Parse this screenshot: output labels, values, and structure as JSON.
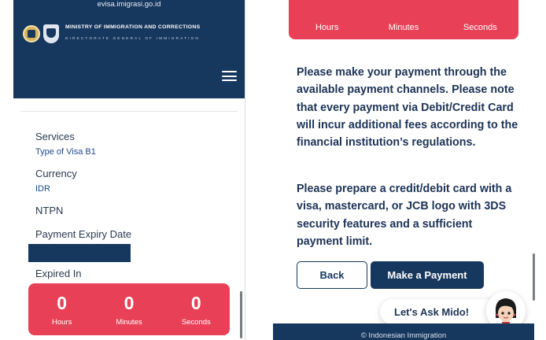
{
  "left": {
    "header": {
      "url": "evisa.imigrasi.go.id",
      "ministry": "MINISTRY OF IMMIGRATION AND CORRECTIONS",
      "directorate": "DIRECTORATE GENERAL OF IMMIGRATION",
      "icons": [
        "coat-of-arms-icon",
        "immigration-emblem-icon",
        "hamburger-menu-icon"
      ]
    },
    "fields": {
      "services_label": "Services",
      "services_value": "Type of Visa B1",
      "currency_label": "Currency",
      "currency_value": "IDR",
      "ntpn_label": "NTPN",
      "expiry_label": "Payment Expiry Date",
      "expired_in_label": "Expired In"
    },
    "timer": {
      "hours": "0",
      "minutes": "0",
      "seconds": "0",
      "hours_label": "Hours",
      "minutes_label": "Minutes",
      "seconds_label": "Seconds"
    }
  },
  "right": {
    "timer": {
      "hours_label": "Hours",
      "minutes_label": "Minutes",
      "seconds_label": "Seconds"
    },
    "paragraphs": [
      "Please make your payment through the available payment channels. Please note that every payment via Debit/Credit Card will incur additional fees according to the financial institution’s regulations.",
      "Please prepare a credit/debit card with a visa, mastercard, or JCB logo with 3DS security features and a sufficient payment limit."
    ],
    "buttons": {
      "back": "Back",
      "pay": "Make a Payment"
    },
    "chat": {
      "label": "Let's Ask Mido!"
    },
    "footer": "© Indonesian Immigration"
  },
  "colors": {
    "navy": "#16375e",
    "timer_red": "#e84157",
    "text_dark": "#1d3356",
    "link_blue": "#1e4a8a"
  }
}
